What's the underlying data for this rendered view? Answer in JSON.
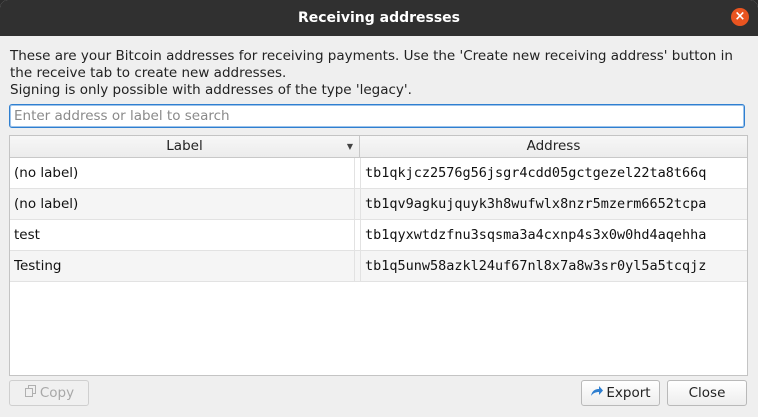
{
  "window": {
    "title": "Receiving addresses",
    "close_glyph": "×"
  },
  "description": {
    "line1": "These are your Bitcoin addresses for receiving payments. Use the 'Create new receiving address' button in",
    "line2": "the receive tab to create new addresses.",
    "line3": "Signing is only possible with addresses of the type 'legacy'."
  },
  "search": {
    "placeholder": "Enter address or label to search",
    "value": ""
  },
  "table": {
    "headers": {
      "label": "Label",
      "address": "Address"
    },
    "rows": [
      {
        "label": "(no label)",
        "address": "tb1qkjcz2576g56jsgr4cdd05gctgezel22ta8t66q"
      },
      {
        "label": "(no label)",
        "address": "tb1qv9agkujquyk3h8wufwlx8nzr5mzerm6652tcpa"
      },
      {
        "label": "test",
        "address": "tb1qyxwtdzfnu3sqsma3a4cxnp4s3x0w0hd4aqehha"
      },
      {
        "label": "Testing",
        "address": "tb1q5unw58azkl24uf67nl8x7a8w3sr0yl5a5tcqjz"
      }
    ]
  },
  "buttons": {
    "copy": "Copy",
    "export": "Export",
    "close": "Close"
  },
  "icons": {
    "copy": "copy-icon",
    "export": "export-icon",
    "sort": "sort-down-icon"
  },
  "colors": {
    "accent": "#e95420",
    "focus": "#2f7fd0"
  }
}
